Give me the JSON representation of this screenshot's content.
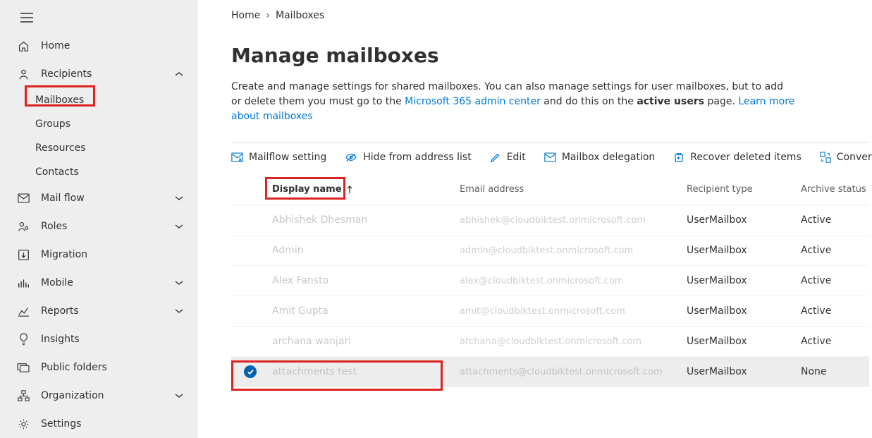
{
  "breadcrumb": {
    "home": "Home",
    "current": "Mailboxes"
  },
  "page": {
    "title": "Manage mailboxes",
    "desc_before": "Create and manage settings for shared mailboxes. You can also manage settings for user mailboxes, but to add or delete them you must go to the ",
    "link1": "Microsoft 365 admin center",
    "desc_mid": " and do this on the ",
    "bold": "active users",
    "desc_after": " page. ",
    "link2": "Learn more about mailboxes"
  },
  "sidebar": {
    "home": "Home",
    "recipients": "Recipients",
    "mailboxes": "Mailboxes",
    "groups": "Groups",
    "resources": "Resources",
    "contacts": "Contacts",
    "mailflow": "Mail flow",
    "roles": "Roles",
    "migration": "Migration",
    "mobile": "Mobile",
    "reports": "Reports",
    "insights": "Insights",
    "publicfolders": "Public folders",
    "organization": "Organization",
    "settings": "Settings"
  },
  "toolbar": {
    "mailflow": "Mailflow setting",
    "hide": "Hide from address list",
    "edit": "Edit",
    "delegation": "Mailbox delegation",
    "recover": "Recover deleted items",
    "convert": "Convert to shared mailbox"
  },
  "table": {
    "headers": {
      "dn": "Display name",
      "em": "Email address",
      "rt": "Recipient type",
      "as": "Archive status"
    },
    "rows": [
      {
        "dn": "Abhishek Dhesman",
        "em": "abhishek@cloudbiktest.onmicrosoft.com",
        "rt": "UserMailbox",
        "as": "Active",
        "selected": false
      },
      {
        "dn": "Admin",
        "em": "admin@cloudbiktest.onmicrosoft.com",
        "rt": "UserMailbox",
        "as": "Active",
        "selected": false
      },
      {
        "dn": "Alex Fansto",
        "em": "alex@cloudbiktest.onmicrosoft.com",
        "rt": "UserMailbox",
        "as": "Active",
        "selected": false
      },
      {
        "dn": "Amit Gupta",
        "em": "amit@cloudbiktest.onmicrosoft.com",
        "rt": "UserMailbox",
        "as": "Active",
        "selected": false
      },
      {
        "dn": "archana wanjari",
        "em": "archana@cloudbiktest.onmicrosoft.com",
        "rt": "UserMailbox",
        "as": "Active",
        "selected": false
      },
      {
        "dn": "attachments test",
        "em": "attachments@cloudbiktest.onmicrosoft.com",
        "rt": "UserMailbox",
        "as": "None",
        "selected": true
      }
    ]
  }
}
